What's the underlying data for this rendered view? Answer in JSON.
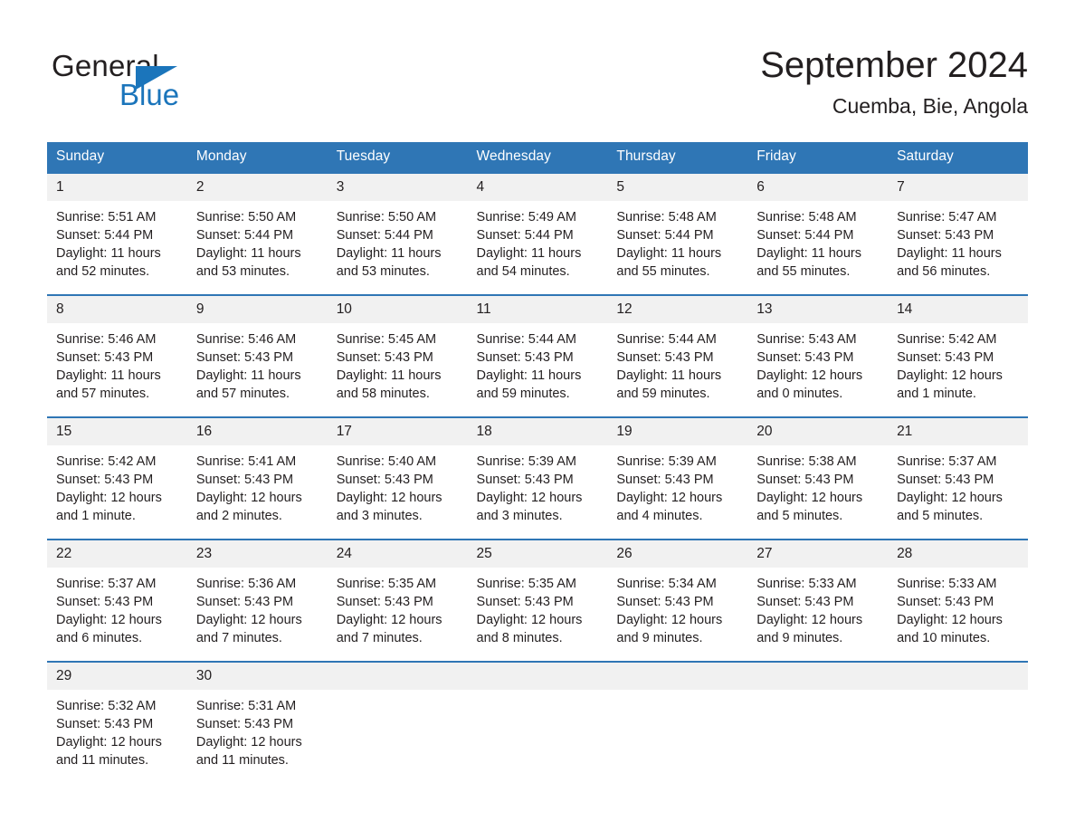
{
  "brand": {
    "name_part1": "General",
    "name_part2": "Blue",
    "logo_icon": "triangle-flag-icon"
  },
  "header": {
    "month_title": "September 2024",
    "location": "Cuemba, Bie, Angola"
  },
  "colors": {
    "header_blue": "#2f76b5",
    "brand_blue": "#1b75bb",
    "daynum_band": "#f1f1f1",
    "text": "#231f20"
  },
  "weekday_headers": [
    "Sunday",
    "Monday",
    "Tuesday",
    "Wednesday",
    "Thursday",
    "Friday",
    "Saturday"
  ],
  "weeks": [
    [
      {
        "day": "1",
        "sunrise": "Sunrise: 5:51 AM",
        "sunset": "Sunset: 5:44 PM",
        "daylight": "Daylight: 11 hours and 52 minutes."
      },
      {
        "day": "2",
        "sunrise": "Sunrise: 5:50 AM",
        "sunset": "Sunset: 5:44 PM",
        "daylight": "Daylight: 11 hours and 53 minutes."
      },
      {
        "day": "3",
        "sunrise": "Sunrise: 5:50 AM",
        "sunset": "Sunset: 5:44 PM",
        "daylight": "Daylight: 11 hours and 53 minutes."
      },
      {
        "day": "4",
        "sunrise": "Sunrise: 5:49 AM",
        "sunset": "Sunset: 5:44 PM",
        "daylight": "Daylight: 11 hours and 54 minutes."
      },
      {
        "day": "5",
        "sunrise": "Sunrise: 5:48 AM",
        "sunset": "Sunset: 5:44 PM",
        "daylight": "Daylight: 11 hours and 55 minutes."
      },
      {
        "day": "6",
        "sunrise": "Sunrise: 5:48 AM",
        "sunset": "Sunset: 5:44 PM",
        "daylight": "Daylight: 11 hours and 55 minutes."
      },
      {
        "day": "7",
        "sunrise": "Sunrise: 5:47 AM",
        "sunset": "Sunset: 5:43 PM",
        "daylight": "Daylight: 11 hours and 56 minutes."
      }
    ],
    [
      {
        "day": "8",
        "sunrise": "Sunrise: 5:46 AM",
        "sunset": "Sunset: 5:43 PM",
        "daylight": "Daylight: 11 hours and 57 minutes."
      },
      {
        "day": "9",
        "sunrise": "Sunrise: 5:46 AM",
        "sunset": "Sunset: 5:43 PM",
        "daylight": "Daylight: 11 hours and 57 minutes."
      },
      {
        "day": "10",
        "sunrise": "Sunrise: 5:45 AM",
        "sunset": "Sunset: 5:43 PM",
        "daylight": "Daylight: 11 hours and 58 minutes."
      },
      {
        "day": "11",
        "sunrise": "Sunrise: 5:44 AM",
        "sunset": "Sunset: 5:43 PM",
        "daylight": "Daylight: 11 hours and 59 minutes."
      },
      {
        "day": "12",
        "sunrise": "Sunrise: 5:44 AM",
        "sunset": "Sunset: 5:43 PM",
        "daylight": "Daylight: 11 hours and 59 minutes."
      },
      {
        "day": "13",
        "sunrise": "Sunrise: 5:43 AM",
        "sunset": "Sunset: 5:43 PM",
        "daylight": "Daylight: 12 hours and 0 minutes."
      },
      {
        "day": "14",
        "sunrise": "Sunrise: 5:42 AM",
        "sunset": "Sunset: 5:43 PM",
        "daylight": "Daylight: 12 hours and 1 minute."
      }
    ],
    [
      {
        "day": "15",
        "sunrise": "Sunrise: 5:42 AM",
        "sunset": "Sunset: 5:43 PM",
        "daylight": "Daylight: 12 hours and 1 minute."
      },
      {
        "day": "16",
        "sunrise": "Sunrise: 5:41 AM",
        "sunset": "Sunset: 5:43 PM",
        "daylight": "Daylight: 12 hours and 2 minutes."
      },
      {
        "day": "17",
        "sunrise": "Sunrise: 5:40 AM",
        "sunset": "Sunset: 5:43 PM",
        "daylight": "Daylight: 12 hours and 3 minutes."
      },
      {
        "day": "18",
        "sunrise": "Sunrise: 5:39 AM",
        "sunset": "Sunset: 5:43 PM",
        "daylight": "Daylight: 12 hours and 3 minutes."
      },
      {
        "day": "19",
        "sunrise": "Sunrise: 5:39 AM",
        "sunset": "Sunset: 5:43 PM",
        "daylight": "Daylight: 12 hours and 4 minutes."
      },
      {
        "day": "20",
        "sunrise": "Sunrise: 5:38 AM",
        "sunset": "Sunset: 5:43 PM",
        "daylight": "Daylight: 12 hours and 5 minutes."
      },
      {
        "day": "21",
        "sunrise": "Sunrise: 5:37 AM",
        "sunset": "Sunset: 5:43 PM",
        "daylight": "Daylight: 12 hours and 5 minutes."
      }
    ],
    [
      {
        "day": "22",
        "sunrise": "Sunrise: 5:37 AM",
        "sunset": "Sunset: 5:43 PM",
        "daylight": "Daylight: 12 hours and 6 minutes."
      },
      {
        "day": "23",
        "sunrise": "Sunrise: 5:36 AM",
        "sunset": "Sunset: 5:43 PM",
        "daylight": "Daylight: 12 hours and 7 minutes."
      },
      {
        "day": "24",
        "sunrise": "Sunrise: 5:35 AM",
        "sunset": "Sunset: 5:43 PM",
        "daylight": "Daylight: 12 hours and 7 minutes."
      },
      {
        "day": "25",
        "sunrise": "Sunrise: 5:35 AM",
        "sunset": "Sunset: 5:43 PM",
        "daylight": "Daylight: 12 hours and 8 minutes."
      },
      {
        "day": "26",
        "sunrise": "Sunrise: 5:34 AM",
        "sunset": "Sunset: 5:43 PM",
        "daylight": "Daylight: 12 hours and 9 minutes."
      },
      {
        "day": "27",
        "sunrise": "Sunrise: 5:33 AM",
        "sunset": "Sunset: 5:43 PM",
        "daylight": "Daylight: 12 hours and 9 minutes."
      },
      {
        "day": "28",
        "sunrise": "Sunrise: 5:33 AM",
        "sunset": "Sunset: 5:43 PM",
        "daylight": "Daylight: 12 hours and 10 minutes."
      }
    ],
    [
      {
        "day": "29",
        "sunrise": "Sunrise: 5:32 AM",
        "sunset": "Sunset: 5:43 PM",
        "daylight": "Daylight: 12 hours and 11 minutes."
      },
      {
        "day": "30",
        "sunrise": "Sunrise: 5:31 AM",
        "sunset": "Sunset: 5:43 PM",
        "daylight": "Daylight: 12 hours and 11 minutes."
      },
      {
        "day": "",
        "sunrise": "",
        "sunset": "",
        "daylight": ""
      },
      {
        "day": "",
        "sunrise": "",
        "sunset": "",
        "daylight": ""
      },
      {
        "day": "",
        "sunrise": "",
        "sunset": "",
        "daylight": ""
      },
      {
        "day": "",
        "sunrise": "",
        "sunset": "",
        "daylight": ""
      },
      {
        "day": "",
        "sunrise": "",
        "sunset": "",
        "daylight": ""
      }
    ]
  ]
}
